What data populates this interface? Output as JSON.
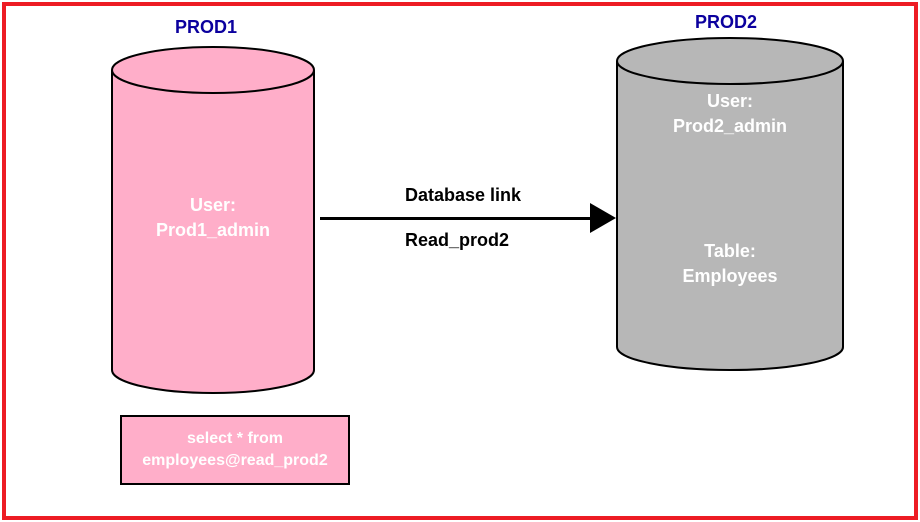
{
  "db1": {
    "title": "PROD1",
    "user_label": "User:",
    "user_name": "Prod1_admin"
  },
  "db2": {
    "title": "PROD2",
    "user_label": "User:",
    "user_name": "Prod2_admin",
    "table_label": "Table:",
    "table_name": "Employees"
  },
  "link": {
    "label_top": "Database link",
    "label_bottom": "Read_prod2"
  },
  "sql": {
    "line1": "select * from",
    "line2": "employees@read_prod2"
  },
  "colors": {
    "border": "#ed1c24",
    "cyl1_fill": "#ffaec9",
    "cyl2_fill": "#b7b7b7",
    "title": "#0b009e"
  }
}
